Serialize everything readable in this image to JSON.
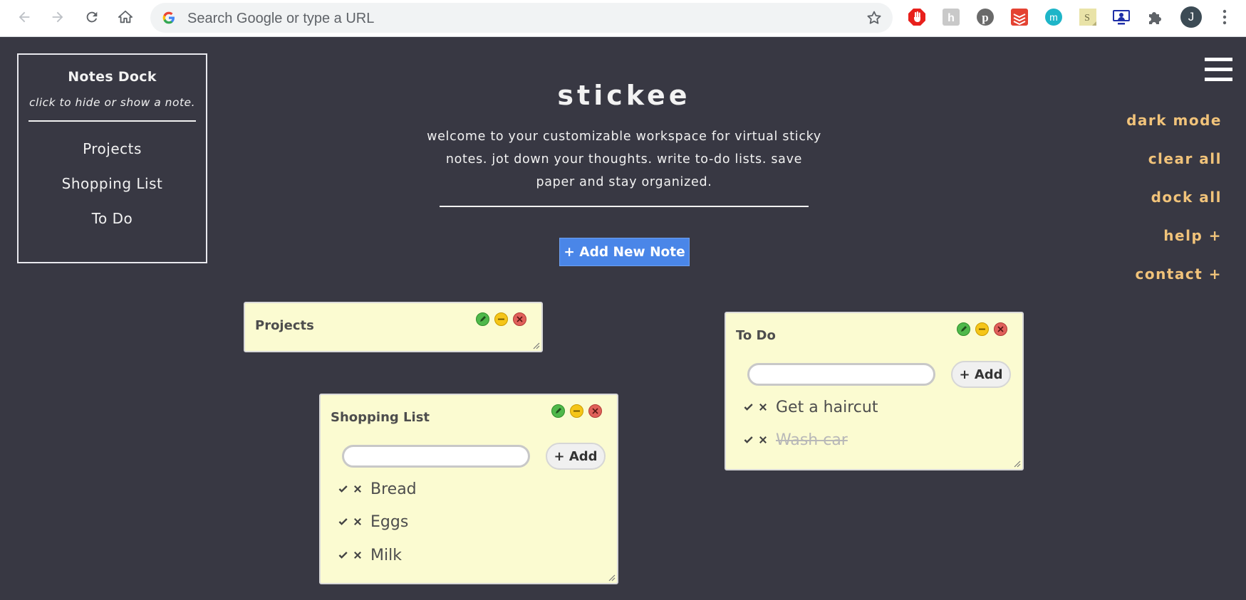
{
  "browser": {
    "omnibox_placeholder": "Search Google or type a URL",
    "profile_initial": "J",
    "extensions": [
      "hand-stop-icon",
      "pumpkin-h-icon",
      "pinterest-icon",
      "todoist-icon",
      "m-circle-icon",
      "sticky-s-icon",
      "screen-monitor-icon",
      "puzzle-icon"
    ]
  },
  "dock": {
    "title": "Notes Dock",
    "subtitle": "click to hide or show a note.",
    "items": [
      {
        "label": "Projects"
      },
      {
        "label": "Shopping List"
      },
      {
        "label": "To Do"
      }
    ]
  },
  "header": {
    "brand": "stickee",
    "welcome": "welcome to your customizable workspace for virtual sticky notes. jot down your thoughts. write to-do lists. save paper and stay organized.",
    "add_note_label": "+ Add New Note"
  },
  "menu": {
    "items": [
      {
        "label": "dark mode"
      },
      {
        "label": "clear all"
      },
      {
        "label": "dock all"
      },
      {
        "label": "help +"
      },
      {
        "label": "contact +"
      }
    ]
  },
  "notes": {
    "projects": {
      "title": "Projects"
    },
    "shopping": {
      "title": "Shopping List",
      "add_label": "+ Add",
      "input_value": "",
      "items": [
        {
          "text": "Bread",
          "done": false
        },
        {
          "text": "Eggs",
          "done": false
        },
        {
          "text": "Milk",
          "done": false
        }
      ]
    },
    "todo": {
      "title": "To Do",
      "add_label": "+ Add",
      "input_value": "",
      "items": [
        {
          "text": "Get a haircut",
          "done": false
        },
        {
          "text": "Wash car",
          "done": true
        }
      ]
    }
  },
  "colors": {
    "background": "#383843",
    "accent": "#f1c37a",
    "note_bg": "#fbfbd1",
    "button_blue": "#4a86e8"
  }
}
